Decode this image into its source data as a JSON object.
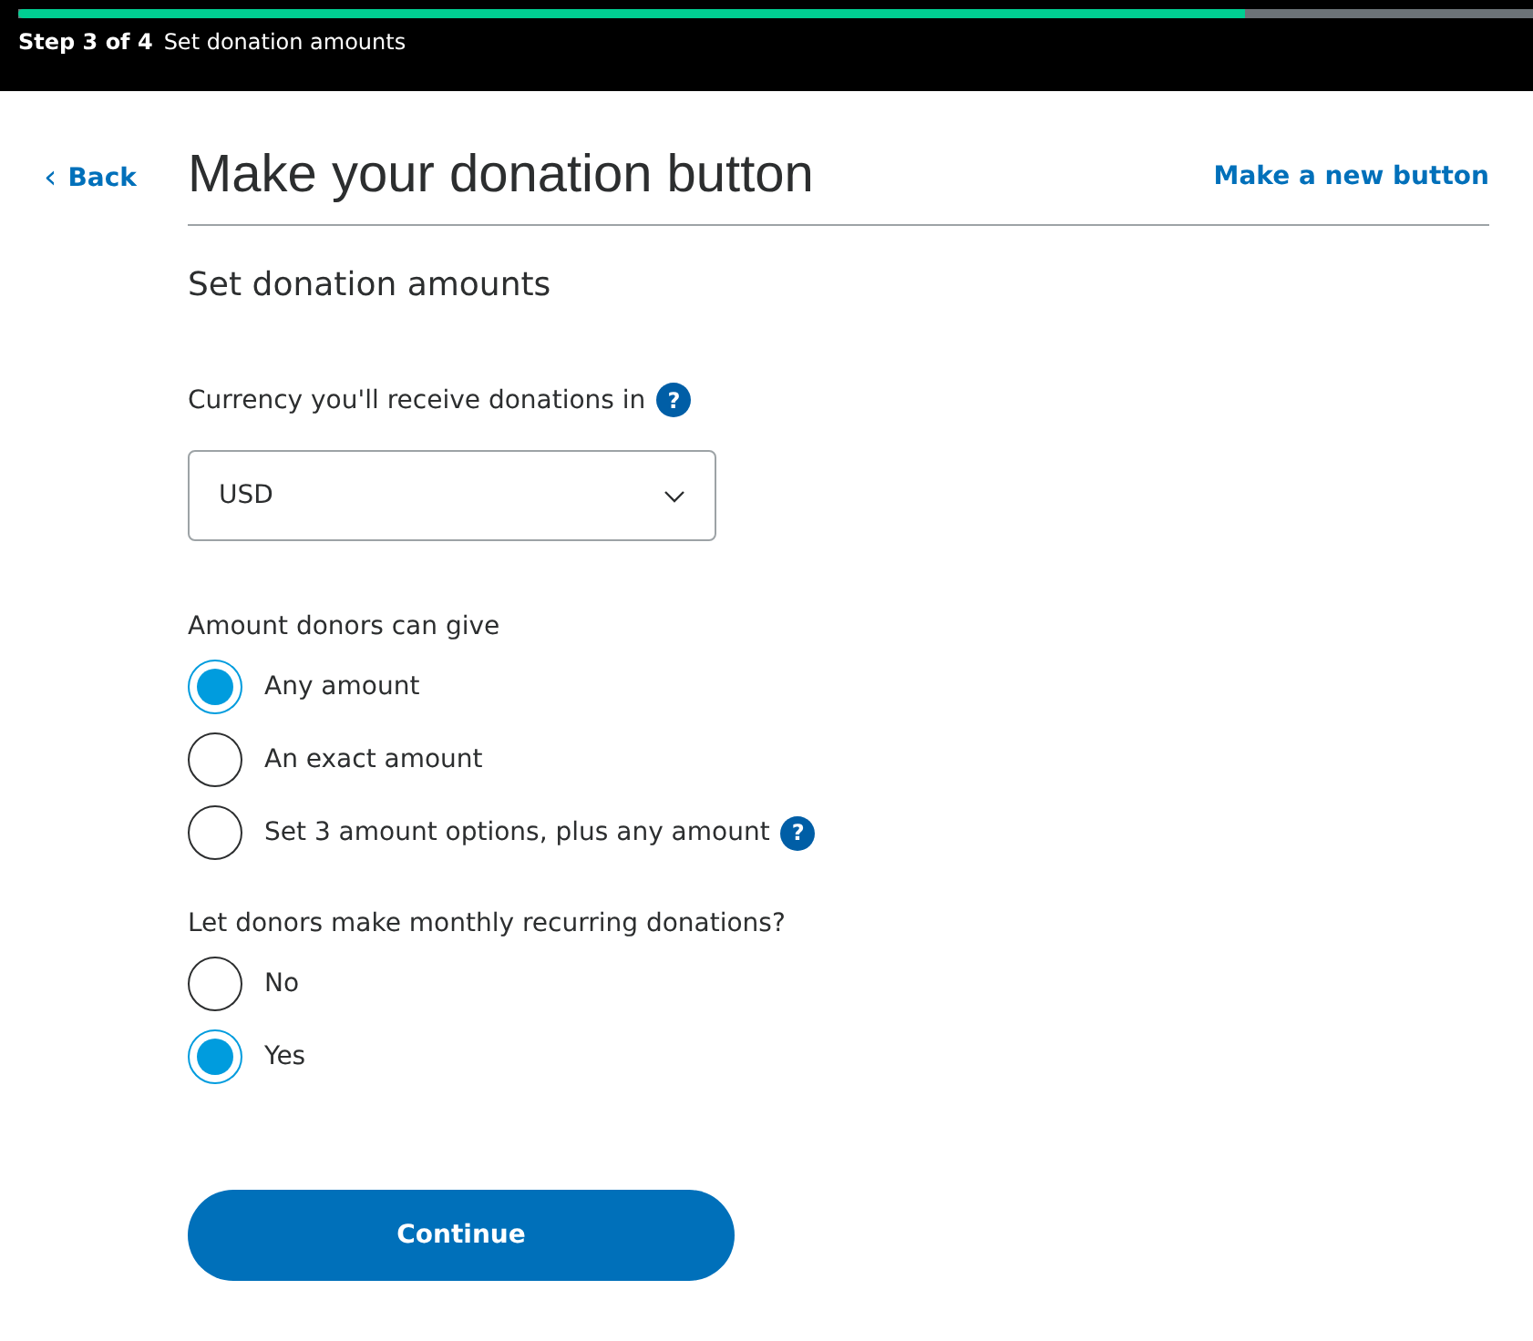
{
  "progress": {
    "level": 0.81,
    "step": "Step 3 of 4",
    "step_title": "Set donation amounts"
  },
  "back_link": {
    "chevron": "‹",
    "label": "Back"
  },
  "title": "Make your donation button",
  "new_button_link": "Make a new button",
  "section_title": "Set donation amounts",
  "currency": {
    "label": "Currency you'll receive donations in",
    "help": "?",
    "value": "USD"
  },
  "amount": {
    "label": "Amount donors can give",
    "options": [
      {
        "label": "Any amount",
        "selected": true
      },
      {
        "label": "An exact amount",
        "selected": false
      },
      {
        "label": "Set 3 amount options, plus any amount",
        "selected": false,
        "help": "?"
      }
    ]
  },
  "recurring": {
    "label": "Let donors make monthly recurring donations?",
    "options": [
      {
        "label": "No",
        "selected": false
      },
      {
        "label": "Yes",
        "selected": true
      }
    ]
  },
  "continue_button": "Continue"
}
